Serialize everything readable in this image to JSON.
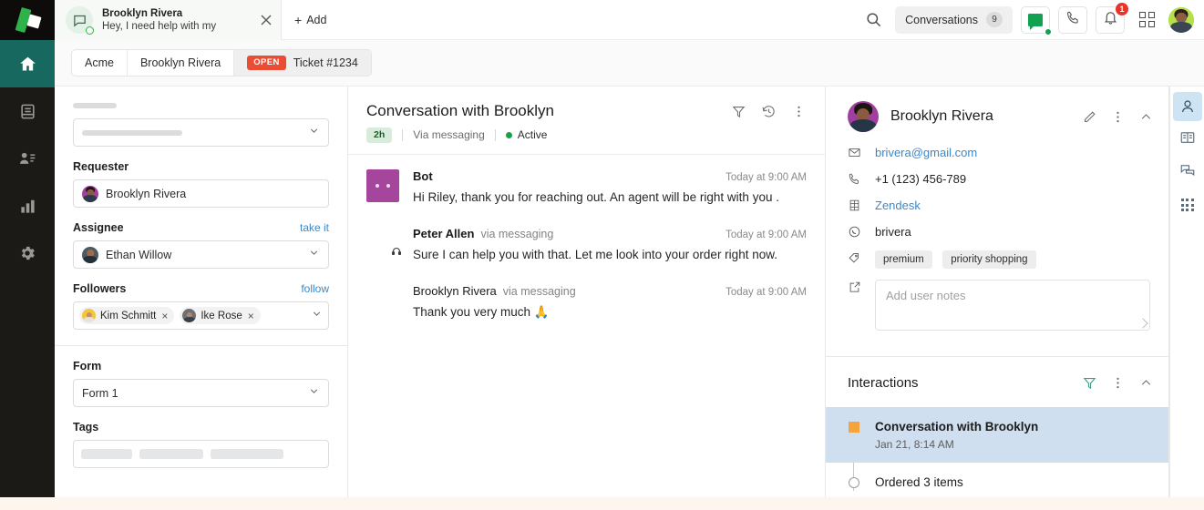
{
  "nav": {
    "logo_name": "brand-logo",
    "items": [
      {
        "name": "home",
        "label": "Home",
        "active": true
      },
      {
        "name": "views",
        "label": "Views",
        "active": false
      },
      {
        "name": "customers",
        "label": "Customers",
        "active": false
      },
      {
        "name": "reporting",
        "label": "Reporting",
        "active": false
      },
      {
        "name": "settings",
        "label": "Settings",
        "active": false
      }
    ]
  },
  "topbar": {
    "tab": {
      "title": "Brooklyn Rivera",
      "subtitle": "Hey, I need help with my",
      "avatar_icon": "speech-bubble-icon",
      "status": "online",
      "close_label": "×"
    },
    "add_label": "Add",
    "add_plus": "+",
    "search_icon": "search-icon",
    "conversations_label": "Conversations",
    "conversations_count": "9",
    "chat_icon": "chat-icon",
    "phone_icon": "phone-icon",
    "bell_icon": "bell-icon",
    "bell_badge": "1",
    "apps_icon": "apps-grid-icon",
    "avatar_icon": "user-avatar"
  },
  "breadcrumb": {
    "org": "Acme",
    "user": "Brooklyn Rivera",
    "status": "OPEN",
    "ticket": "Ticket #1234",
    "status_color": "#ea4d33"
  },
  "properties": {
    "skeleton_label": "",
    "skeleton_value": "",
    "requester_label": "Requester",
    "requester_value": "Brooklyn Rivera",
    "assignee_label": "Assignee",
    "assignee_action": "take it",
    "assignee_value": "Ethan Willow",
    "followers_label": "Followers",
    "followers_action": "follow",
    "followers": [
      {
        "name": "Kim Schmitt",
        "remove": "×"
      },
      {
        "name": "Ike Rose",
        "remove": "×"
      }
    ],
    "form_label": "Form",
    "form_value": "Form 1",
    "tags_label": "Tags"
  },
  "conversation": {
    "title": "Conversation with Brooklyn",
    "duration_badge": "2h",
    "channel": "Via messaging",
    "state": "Active",
    "filter_icon": "filter-icon",
    "history_icon": "history-icon",
    "more_icon": "more-vertical-icon",
    "messages": [
      {
        "author": "Bot",
        "author_bold": true,
        "via": "",
        "time": "Today at 9:00 AM",
        "text": "Hi Riley, thank you for reaching out. An agent will be right with you .",
        "avatar_kind": "bot-square"
      },
      {
        "author": "Peter Allen",
        "author_bold": true,
        "via": "via messaging",
        "time": "Today at 9:00 AM",
        "text": "Sure I can help you with that. Let me look into your order right now.",
        "avatar_kind": "agent-photo"
      },
      {
        "author": "Brooklyn Rivera",
        "author_bold": false,
        "via": "via messaging",
        "time": "Today at 9:00 AM",
        "text": "Thank you very much 🙏",
        "avatar_kind": "customer-photo"
      }
    ]
  },
  "context": {
    "name": "Brooklyn Rivera",
    "edit_icon": "pencil-icon",
    "more_icon": "more-vertical-icon",
    "collapse_icon": "chevron-up-icon",
    "fields": [
      {
        "icon": "envelope-icon",
        "value": "brivera@gmail.com",
        "link": true
      },
      {
        "icon": "phone-icon",
        "value": "+1 (123) 456-789",
        "link": false
      },
      {
        "icon": "organization-icon",
        "value": "Zendesk",
        "link": true
      },
      {
        "icon": "whatsapp-icon",
        "value": "brivera",
        "link": false
      }
    ],
    "tags_icon": "tag-icon",
    "tags": [
      "premium",
      "priority shopping"
    ],
    "notes_icon": "note-edit-icon",
    "notes_placeholder": "Add user notes",
    "interactions_title": "Interactions",
    "interactions_filter_icon": "filter-icon",
    "interactions_more_icon": "more-vertical-icon",
    "interactions_collapse_icon": "chevron-up-icon",
    "interactions": [
      {
        "title": "Conversation with Brooklyn",
        "subtitle": "Jan 21, 8:14 AM",
        "selected": true,
        "marker": "square"
      },
      {
        "title": "Ordered 3 items",
        "subtitle": "",
        "selected": false,
        "marker": "circle"
      }
    ]
  },
  "iconrail": [
    {
      "name": "user-icon",
      "active": true
    },
    {
      "name": "knowledge-book-icon",
      "active": false
    },
    {
      "name": "conversations-icon",
      "active": false
    },
    {
      "name": "apps-grid-icon",
      "active": false
    }
  ]
}
